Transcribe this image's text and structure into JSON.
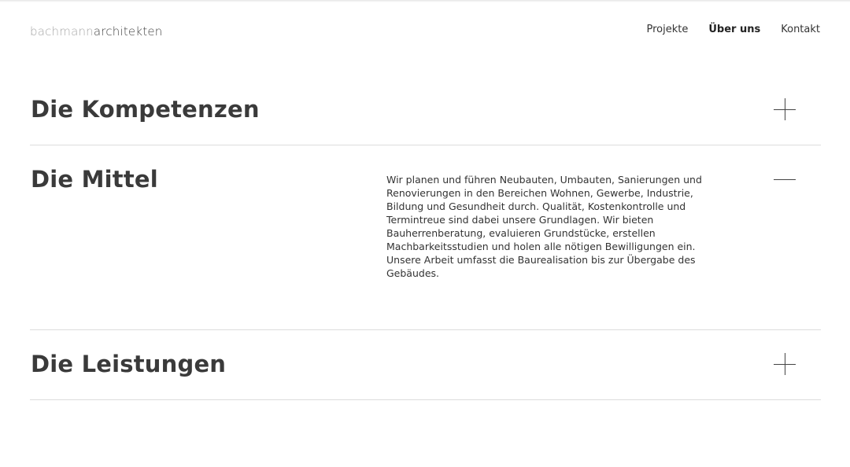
{
  "header": {
    "logo_light": "bachmann",
    "logo_dark": "architekten",
    "nav": [
      {
        "label": "Projekte",
        "active": false
      },
      {
        "label": "Über uns",
        "active": true
      },
      {
        "label": "Kontakt",
        "active": false
      }
    ]
  },
  "sections": [
    {
      "title": "Die Kompetenzen",
      "state": "collapsed",
      "toggle_icon": "plus-icon"
    },
    {
      "title": "Die Mittel",
      "state": "expanded",
      "toggle_icon": "minus-icon",
      "body": "Wir planen und führen Neubauten, Umbauten, Sanierungen und Renovierungen in den Bereichen Wohnen, Gewerbe, Industrie, Bildung und Gesundheit durch. Qualität, Kostenkontrolle und Termintreue sind dabei unsere Grundlagen. Wir bieten Bauherrenberatung, evaluieren Grundstücke, erstellen Machbarkeitsstudien und holen alle nötigen Bewilligungen ein. Unsere Arbeit umfasst die Baurealisation bis zur Übergabe des Gebäudes."
    },
    {
      "title": "Die Leistungen",
      "state": "collapsed",
      "toggle_icon": "plus-icon"
    }
  ],
  "colors": {
    "text": "#333333",
    "logo_light": "#a9a9a9",
    "divider": "#dcdcdc"
  }
}
